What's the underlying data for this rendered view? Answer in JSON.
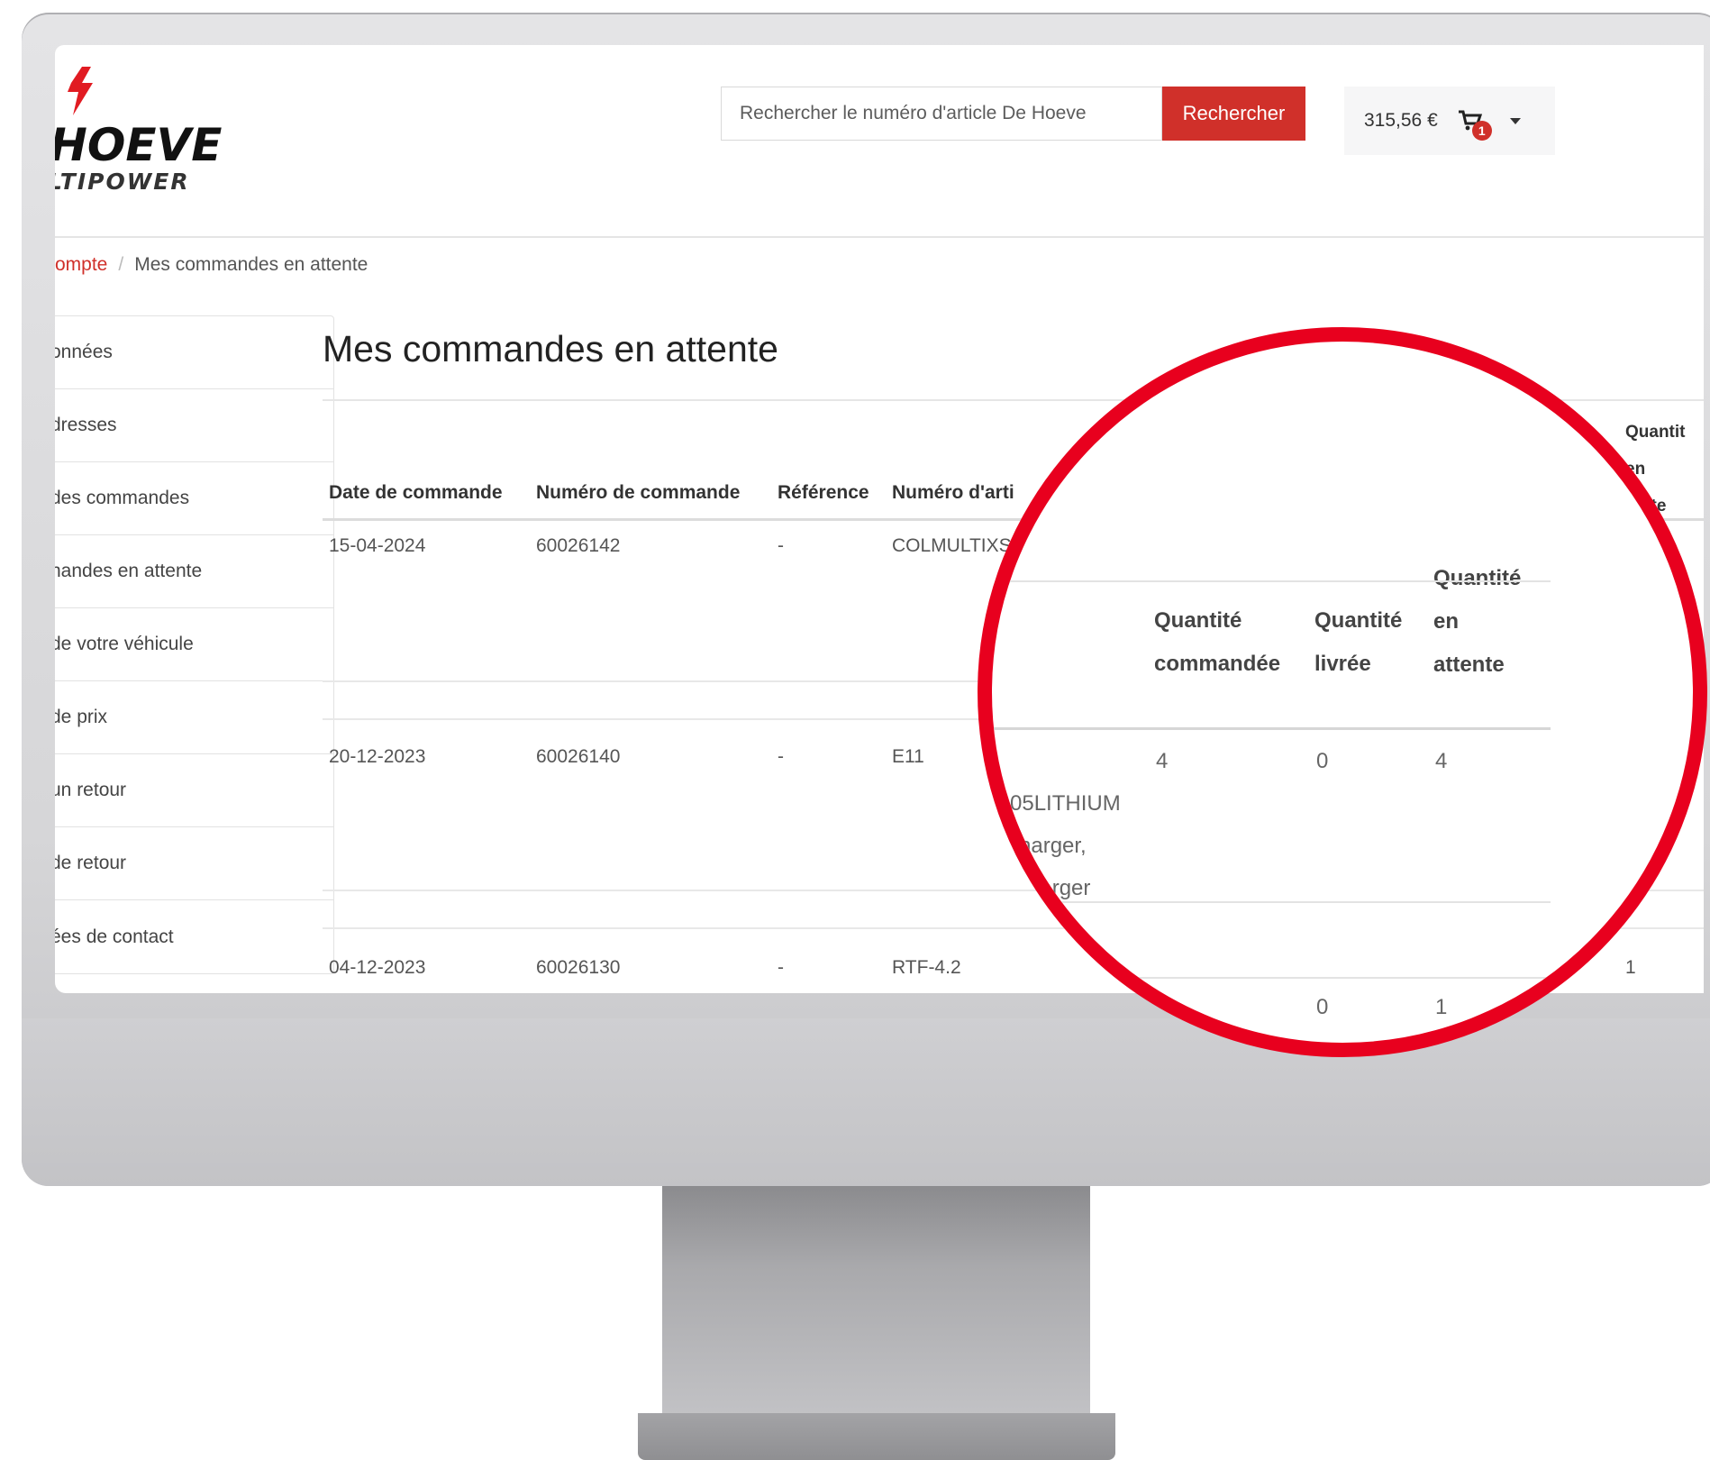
{
  "header": {
    "logo_lines": [
      "HOEVE",
      "LTIPOWER"
    ],
    "search_placeholder": "Rechercher le numéro d'article De Hoeve",
    "search_button": "Rechercher",
    "cart_total": "315,56 €",
    "cart_count": "1"
  },
  "breadcrumb": {
    "parent": "ompte",
    "separator": "/",
    "current": "Mes commandes en attente"
  },
  "sidebar": {
    "items": [
      "onnées",
      "dresses",
      "des commandes",
      "nandes en attente",
      "de votre véhicule",
      "de prix",
      "un retour",
      "de retour",
      "ées de contact"
    ]
  },
  "main": {
    "title": "Mes commandes en attente",
    "columns": {
      "date": "Date de commande",
      "order_number": "Numéro de commande",
      "reference": "Référence",
      "article": "Numéro d'arti",
      "pending_edge": [
        "Quantit",
        "en",
        "tente"
      ]
    },
    "rows": [
      {
        "date": "15-04-2024",
        "order_number": "60026142",
        "reference": "-",
        "article": "COLMULTIXS"
      },
      {
        "date": "20-12-2023",
        "order_number": "60026140",
        "reference": "-",
        "article": "E11"
      },
      {
        "date": "04-12-2023",
        "order_number": "60026130",
        "reference": "-",
        "article": "RTF-4.2",
        "pending": "1"
      }
    ]
  },
  "magnifier": {
    "headers": {
      "ordered": [
        "Quantité",
        "commandée"
      ],
      "delivered": [
        "Quantité",
        "livrée"
      ],
      "pending": [
        "Quantité",
        "en",
        "attente"
      ]
    },
    "row1": {
      "ordered": "4",
      "delivered": "0",
      "pending": "4"
    },
    "desc_lines": [
      "05LITHIUM",
      "harger,",
      "harger"
    ],
    "row3": {
      "delivered": "0",
      "pending": "1"
    }
  },
  "colors": {
    "brand_red": "#d0302a",
    "highlight_ring": "#e8001e"
  }
}
